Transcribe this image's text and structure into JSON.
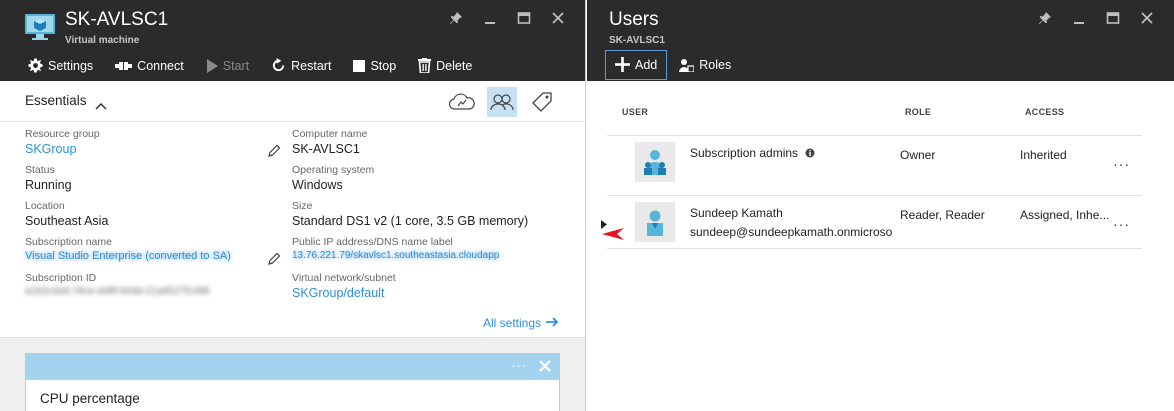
{
  "vm_blade": {
    "title": "SK-AVLSC1",
    "subtitle": "Virtual machine",
    "commands": [
      {
        "label": "Settings",
        "icon": "gear-icon",
        "enabled": true
      },
      {
        "label": "Connect",
        "icon": "connect-icon",
        "enabled": true
      },
      {
        "label": "Start",
        "icon": "play-icon",
        "enabled": false
      },
      {
        "label": "Restart",
        "icon": "restart-icon",
        "enabled": true
      },
      {
        "label": "Stop",
        "icon": "stop-icon",
        "enabled": true
      },
      {
        "label": "Delete",
        "icon": "trash-icon",
        "enabled": true
      }
    ],
    "essentials": {
      "label": "Essentials",
      "tools": [
        "cloud-icon",
        "users-icon",
        "tag-icon"
      ],
      "left": [
        {
          "label": "Resource group",
          "value": "SKGroup",
          "link": true,
          "editable": true
        },
        {
          "label": "Status",
          "value": "Running"
        },
        {
          "label": "Location",
          "value": "Southeast Asia"
        },
        {
          "label": "Subscription name",
          "value": "Visual Studio Enterprise (converted to SA)",
          "blurred": true,
          "editable": true
        },
        {
          "label": "Subscription ID",
          "value": "a1b2c3d4-78ce-4d9f-b0dd-21a6527f1488",
          "blurred": true
        }
      ],
      "right": [
        {
          "label": "Computer name",
          "value": "SK-AVLSC1"
        },
        {
          "label": "Operating system",
          "value": "Windows"
        },
        {
          "label": "Size",
          "value": "Standard DS1 v2 (1 core, 3.5 GB memory)"
        },
        {
          "label": "Public IP address/DNS name label",
          "value": "13.76.221.79/skavlsc1.southeastasia.cloudapp",
          "blurred": true
        },
        {
          "label": "Virtual network/subnet",
          "value": "SKGroup/default",
          "link": true
        }
      ],
      "all_settings": "All settings"
    },
    "tile": {
      "title": "CPU percentage",
      "more": "···"
    }
  },
  "users_blade": {
    "title": "Users",
    "subtitle": "SK-AVLSC1",
    "commands": [
      {
        "label": "Add",
        "icon": "plus-icon"
      },
      {
        "label": "Roles",
        "icon": "roles-icon"
      }
    ],
    "columns": [
      "USER",
      "ROLE",
      "ACCESS"
    ],
    "rows": [
      {
        "name": "Subscription admins",
        "email": "",
        "role": "Owner",
        "access": "Inherited",
        "more": "···"
      },
      {
        "name": "Sundeep Kamath",
        "email": "sundeep@sundeepkamath.onmicrosoft.com",
        "role": "Reader, Reader",
        "access": "Assigned, Inhe...",
        "more": "···"
      }
    ]
  },
  "colors": {
    "header_bg": "#2b2b2b",
    "link": "#2f8fd6",
    "tile_header": "#a4d3f0",
    "avatar_blue": "#59b4d9",
    "pointer_red": "#e81123"
  }
}
